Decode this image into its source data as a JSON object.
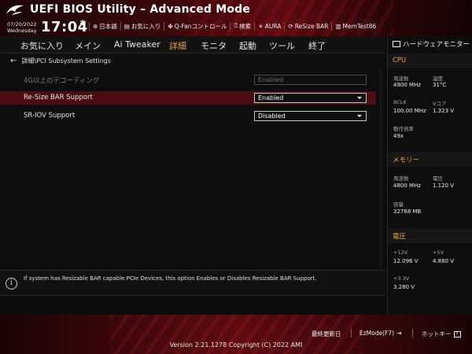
{
  "header": {
    "title": "UEFI BIOS Utility – Advanced Mode",
    "date": "07/20/2022",
    "weekday": "Wednesday",
    "time": "17:04",
    "toolbar": [
      {
        "icon": "globe-icon",
        "label": "日本語"
      },
      {
        "icon": "favorites-icon",
        "label": "お気に入り"
      },
      {
        "icon": "fan-icon",
        "label": "Q-Fanコントロール"
      },
      {
        "icon": "search-icon",
        "label": "検索"
      },
      {
        "icon": "aura-icon",
        "label": "AURA"
      },
      {
        "icon": "resize-bar-icon",
        "label": "ReSize BAR"
      },
      {
        "icon": "memtest-icon",
        "label": "MemTest86"
      }
    ]
  },
  "tabs": [
    {
      "label": "お気に入り",
      "active": false
    },
    {
      "label": "メイン",
      "active": false
    },
    {
      "label": "Ai Tweaker",
      "active": false
    },
    {
      "label": "詳細",
      "active": true
    },
    {
      "label": "モニタ",
      "active": false
    },
    {
      "label": "起動",
      "active": false
    },
    {
      "label": "ツール",
      "active": false
    },
    {
      "label": "終了",
      "active": false
    }
  ],
  "main": {
    "breadcrumb": "詳細\\PCI Subsystem Settings",
    "settings": [
      {
        "label": "4G以上のデコーディング",
        "value": "Enabled",
        "disabled": true,
        "selected": false
      },
      {
        "label": "Re-Size BAR Support",
        "value": "Enabled",
        "disabled": false,
        "selected": true
      },
      {
        "label": "SR-IOV Support",
        "value": "Disabled",
        "disabled": false,
        "selected": false
      }
    ]
  },
  "info": {
    "text": "If system has Resizable BAR capable PCIe Devices, this option Enables or Disables Resizable BAR Support."
  },
  "hw_monitor": {
    "title": "ハードウェアモニター",
    "cpu": {
      "heading": "CPU",
      "freq_label": "周波数",
      "freq": "4900 MHz",
      "temp_label": "温度",
      "temp": "31°C",
      "bclk_label": "BCLK",
      "bclk": "100.00 MHz",
      "vcore_label": "Vコア",
      "vcore": "1.323 V",
      "ratio_label": "動作倍率",
      "ratio": "49x"
    },
    "memory": {
      "heading": "メモリー",
      "freq_label": "周波数",
      "freq": "4800 MHz",
      "volt_label": "電圧",
      "volt": "1.120 V",
      "cap_label": "容量",
      "cap": "32768 MB"
    },
    "voltage": {
      "heading": "電圧",
      "v12_label": "+12V",
      "v12": "12.096 V",
      "v5_label": "+5V",
      "v5": "4.880 V",
      "v33_label": "+3.3V",
      "v33": "3.280 V"
    }
  },
  "footer": {
    "last_modified": "最終更新日",
    "ezmode": "EzMode(F7)",
    "hotkeys": "ホットキー",
    "hotkey_key": "?",
    "copyright": "Version 2.21.1278 Copyright (C) 2022 AMI"
  },
  "colors": {
    "accent": "#e8a23a",
    "highlight_row": "#4a0d12",
    "header_red": "#5c0a10"
  }
}
